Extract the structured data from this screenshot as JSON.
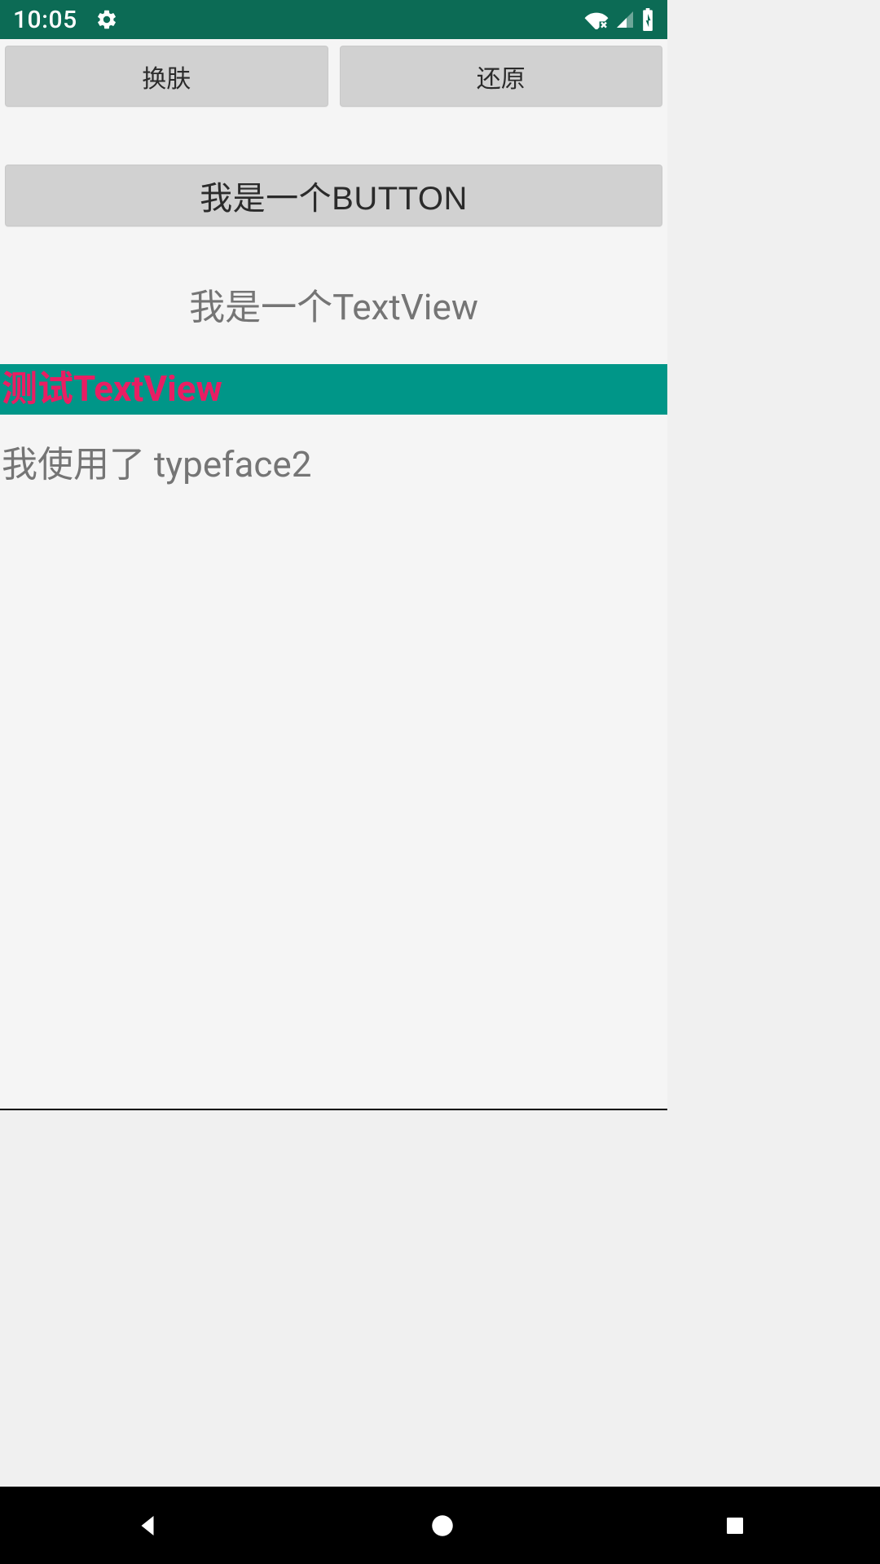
{
  "status": {
    "time": "10:05"
  },
  "buttons": {
    "change_skin": "换肤",
    "restore": "还原",
    "big_button": "我是一个BUTTON"
  },
  "textviews": {
    "tv1": "我是一个TextView",
    "tv2": "测试TextView",
    "tv3": "我使用了 typeface2"
  },
  "colors": {
    "status_bar": "#0c6b55",
    "button_bg": "#d1d1d1",
    "tv2_bg": "#009688",
    "tv2_fg": "#e91e63",
    "muted_text": "#757575"
  }
}
